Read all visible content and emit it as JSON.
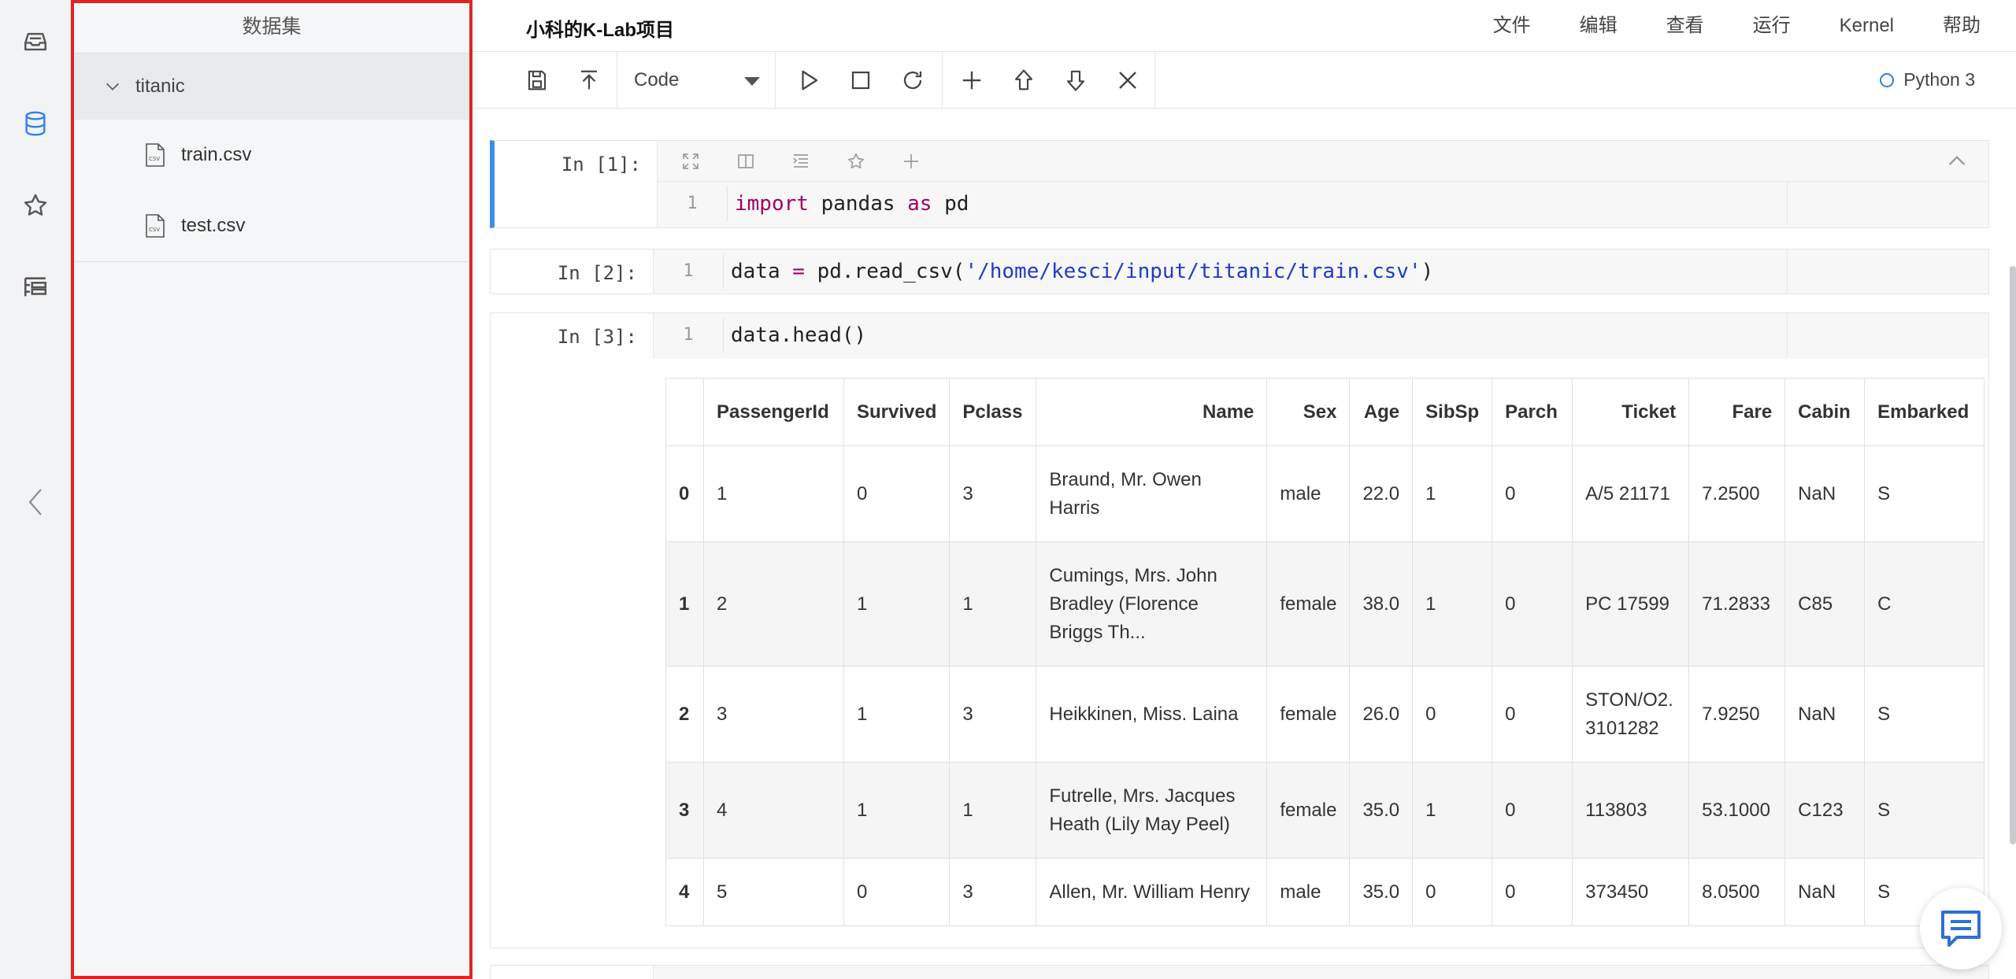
{
  "app": {
    "project_title": "小科的K-Lab项目"
  },
  "colors": {
    "accent": "#3c8ee8",
    "rail_active": "#2f80ed",
    "panel_highlight_border": "#e02424",
    "keyword": "#a20060",
    "string": "#1f3bc6"
  },
  "rail": {
    "items": [
      {
        "icon": "inbox-icon"
      },
      {
        "icon": "database-icon",
        "active": true
      },
      {
        "icon": "star-icon"
      },
      {
        "icon": "list-tree-icon"
      }
    ],
    "collapse_icon": "chevron-left-icon"
  },
  "dataset_panel": {
    "title": "数据集",
    "folder": {
      "name": "titanic",
      "expanded": true
    },
    "files": [
      {
        "name": "train.csv",
        "icon": "csv-file-icon"
      },
      {
        "name": "test.csv",
        "icon": "csv-file-icon"
      }
    ]
  },
  "menubar": {
    "items": [
      "文件",
      "编辑",
      "查看",
      "运行",
      "Kernel",
      "帮助"
    ]
  },
  "toolbar": {
    "cell_type": "Code",
    "kernel_name": "Python 3",
    "buttons": [
      "save-icon",
      "upload-icon",
      "run-icon",
      "stop-icon",
      "restart-icon",
      "add-icon",
      "move-up-icon",
      "move-down-icon",
      "delete-icon"
    ]
  },
  "cells": [
    {
      "prompt": "In [1]:",
      "line_no": "1",
      "code": {
        "kw1": "import",
        "mid": " pandas ",
        "kw2": "as",
        "end": " pd"
      }
    },
    {
      "prompt": "In [2]:",
      "line_no": "1",
      "code": {
        "pre": "data ",
        "op": "=",
        "mid": " pd.read_csv(",
        "str": "'/home/kesci/input/titanic/train.csv'",
        "end": ")"
      }
    },
    {
      "prompt": "In [3]:",
      "line_no": "1",
      "code": {
        "text": "data.head()"
      }
    }
  ],
  "output_table": {
    "columns": [
      "",
      "PassengerId",
      "Survived",
      "Pclass",
      "Name",
      "Sex",
      "Age",
      "SibSp",
      "Parch",
      "Ticket",
      "Fare",
      "Cabin",
      "Embarked"
    ],
    "rows": [
      [
        "0",
        "1",
        "0",
        "3",
        "Braund, Mr. Owen Harris",
        "male",
        "22.0",
        "1",
        "0",
        "A/5 21171",
        "7.2500",
        "NaN",
        "S"
      ],
      [
        "1",
        "2",
        "1",
        "1",
        "Cumings, Mrs. John Bradley (Florence Briggs Th...",
        "female",
        "38.0",
        "1",
        "0",
        "PC 17599",
        "71.2833",
        "C85",
        "C"
      ],
      [
        "2",
        "3",
        "1",
        "3",
        "Heikkinen, Miss. Laina",
        "female",
        "26.0",
        "0",
        "0",
        "STON/O2. 3101282",
        "7.9250",
        "NaN",
        "S"
      ],
      [
        "3",
        "4",
        "1",
        "1",
        "Futrelle, Mrs. Jacques Heath (Lily May Peel)",
        "female",
        "35.0",
        "1",
        "0",
        "113803",
        "53.1000",
        "C123",
        "S"
      ],
      [
        "4",
        "5",
        "0",
        "3",
        "Allen, Mr. William Henry",
        "male",
        "35.0",
        "0",
        "0",
        "373450",
        "8.0500",
        "NaN",
        "S"
      ]
    ]
  }
}
